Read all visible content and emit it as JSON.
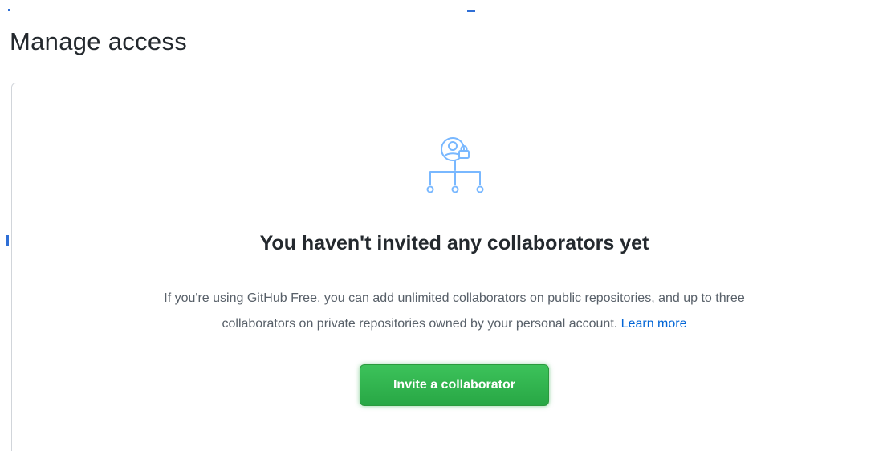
{
  "header": {
    "title": "Manage access"
  },
  "empty_state": {
    "icon": "person-lock-network-icon",
    "heading": "You haven't invited any collaborators yet",
    "description_line1": "If you're using GitHub Free, you can add unlimited collaborators on public repositories, and up to three",
    "description_line2": "collaborators on private repositories owned by your personal account.",
    "learn_more": "Learn more",
    "invite_button": "Invite a collaborator"
  },
  "colors": {
    "accent_link": "#0366d6",
    "button_green": "#28a745",
    "icon_blue": "#79b8ff"
  }
}
